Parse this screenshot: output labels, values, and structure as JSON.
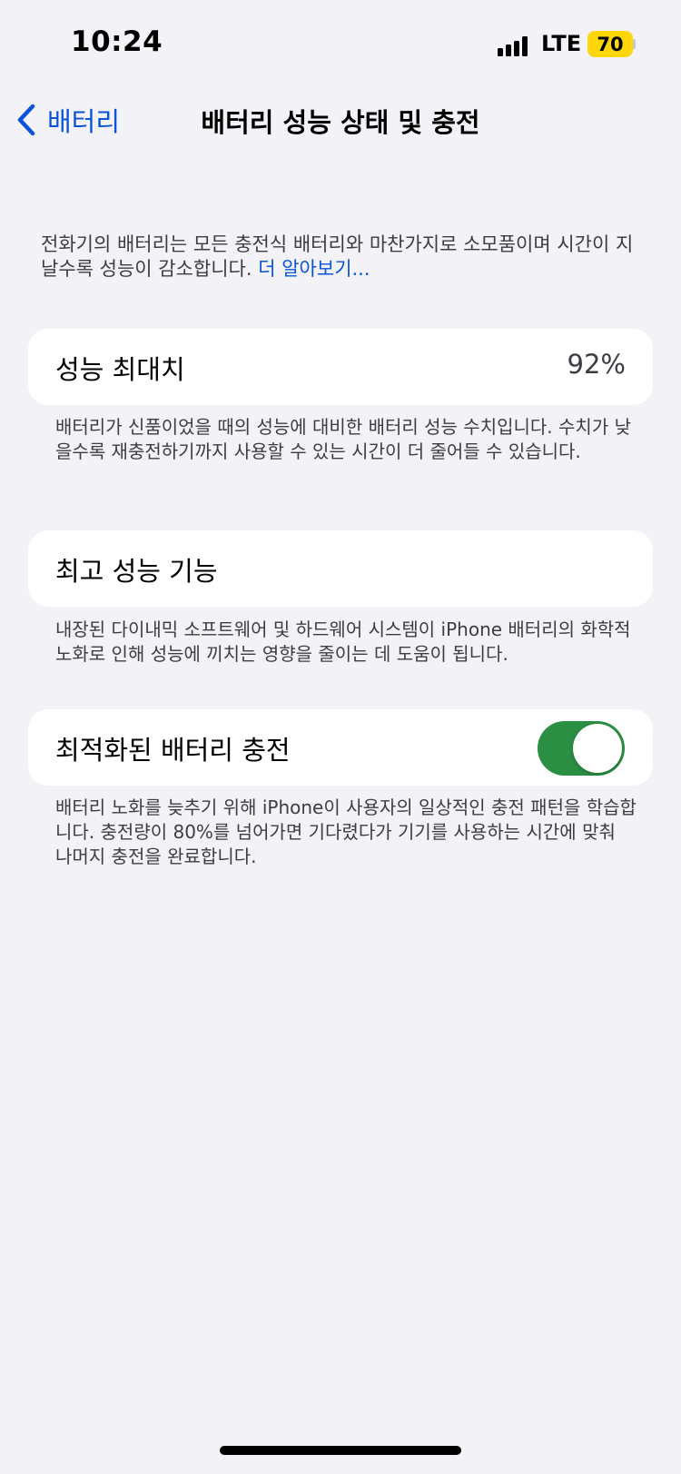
{
  "status_bar": {
    "time": "10:24",
    "carrier": "LTE",
    "battery_level": "70",
    "battery_color": "#ffd60a",
    "signal_bars": 4
  },
  "nav": {
    "back_label": "배터리",
    "back_icon": "chevron-left-icon",
    "title": "배터리 성능 상태 및 충전"
  },
  "intro": {
    "text": "전화기의 배터리는 모든 충전식 배터리와 마찬가지로 소모품이며 시간이 지날수록 성능이 감소합니다.",
    "link": "더 알아보기..."
  },
  "max_capacity": {
    "label": "성능 최대치",
    "value": "92%",
    "footer": "배터리가 신품이었을 때의 성능에 대비한 배터리 성능 수치입니다. 수치가 낮을수록 재충전하기까지 사용할 수 있는 시간이 더 줄어들 수 있습니다."
  },
  "peak_performance": {
    "label": "최고 성능 기능",
    "footer": "내장된 다이내믹 소프트웨어 및 하드웨어 시스템이 iPhone 배터리의 화학적 노화로 인해 성능에 끼치는 영향을 줄이는 데 도움이 됩니다."
  },
  "optimized_charging": {
    "label": "최적화된 배터리 충전",
    "enabled": true,
    "toggle_color": "#2a8e43",
    "footer": "배터리 노화를 늦추기 위해 iPhone이 사용자의 일상적인 충전 패턴을 학습합니다. 충전량이 80%를 넘어가면 기다렸다가 기기를 사용하는 시간에 맞춰 나머지 충전을 완료합니다."
  },
  "colors": {
    "accent": "#0a54d8",
    "background": "#f2f2f7"
  }
}
